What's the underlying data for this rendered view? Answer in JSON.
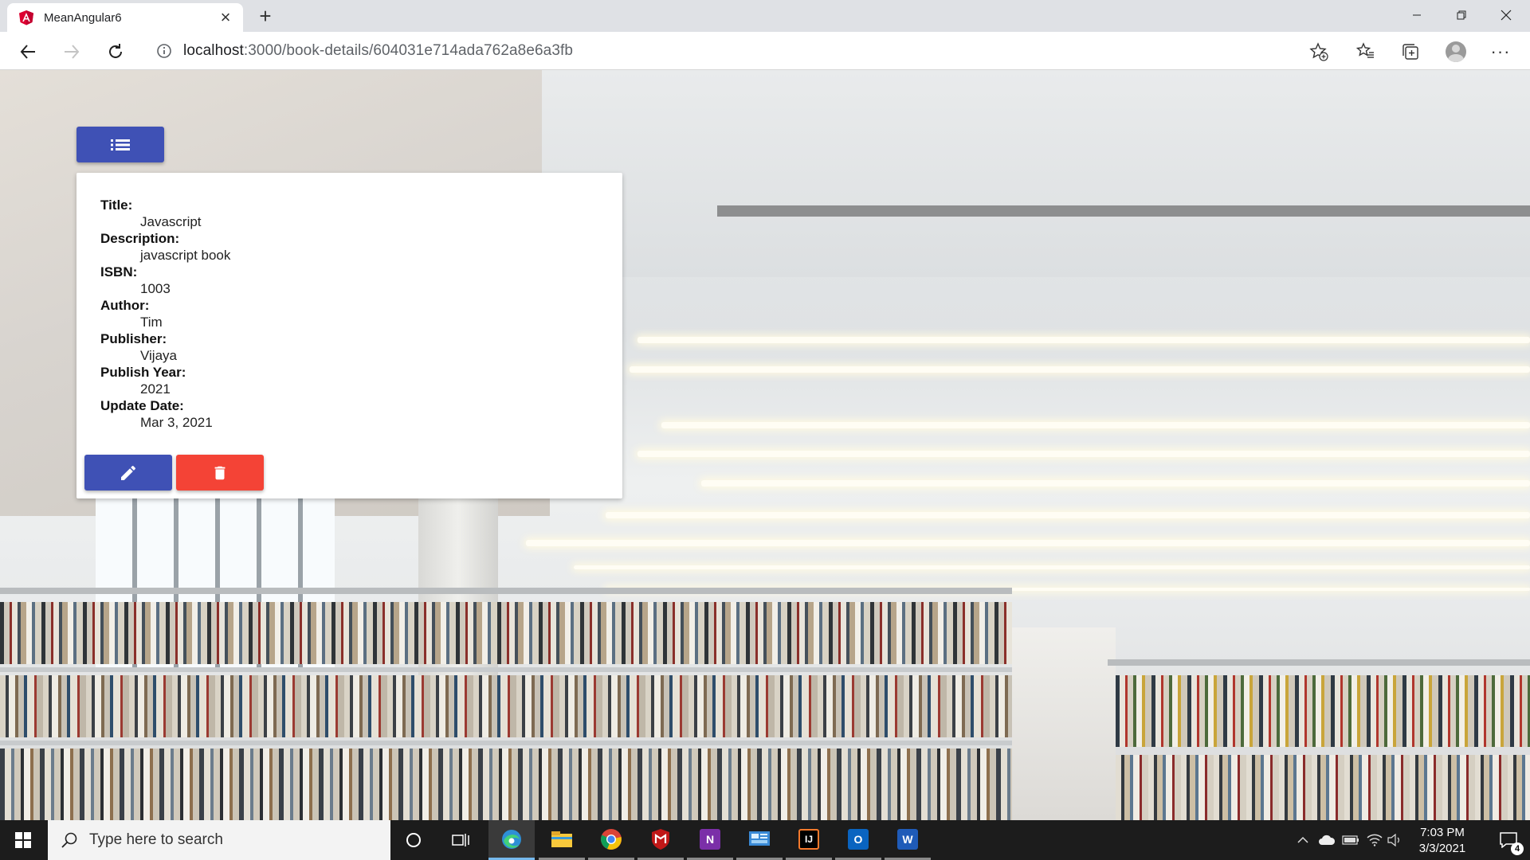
{
  "browser": {
    "tab_title": "MeanAngular6",
    "url_host": "localhost",
    "url_rest": ":3000/book-details/604031e714ada762a8e6a3fb",
    "icons": {
      "back": "arrow-left-icon",
      "forward": "arrow-right-icon",
      "reload": "reload-icon",
      "info": "info-icon",
      "add_favorite": "star-plus-icon",
      "favorites": "favorites-icon",
      "collections": "collections-icon",
      "profile": "avatar",
      "more": "more-icon"
    }
  },
  "book": {
    "fields": [
      {
        "label": "Title:",
        "value": "Javascript"
      },
      {
        "label": "Description:",
        "value": "javascript book"
      },
      {
        "label": "ISBN:",
        "value": "1003"
      },
      {
        "label": "Author:",
        "value": "Tim"
      },
      {
        "label": "Publisher:",
        "value": "Vijaya"
      },
      {
        "label": "Publish Year:",
        "value": "2021"
      },
      {
        "label": "Update Date:",
        "value": "Mar 3, 2021"
      }
    ],
    "colors": {
      "primary": "#3f51b5",
      "warn": "#f44336"
    }
  },
  "taskbar": {
    "search_placeholder": "Type here to search",
    "time": "7:03 PM",
    "date": "3/3/2021",
    "notification_count": "4",
    "apps": [
      "cortana",
      "task-view",
      "edge",
      "file-explorer",
      "chrome",
      "mcafee",
      "onenote",
      "control-panel",
      "intellij",
      "outlook",
      "word"
    ]
  }
}
